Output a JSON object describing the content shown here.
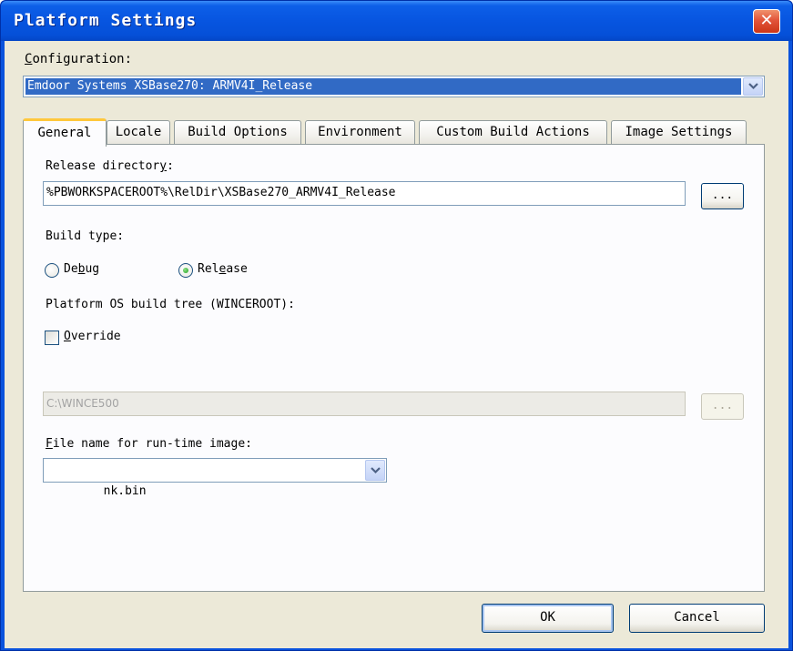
{
  "window": {
    "title": "Platform Settings",
    "close_glyph": "✕"
  },
  "configuration": {
    "label_first": "C",
    "label_rest": "onfiguration:",
    "selected": "Emdoor Systems XSBase270: ARMV4I_Release"
  },
  "tabs": [
    {
      "label": "General",
      "active": true
    },
    {
      "label": "Locale",
      "active": false
    },
    {
      "label": "Build Options",
      "active": false
    },
    {
      "label": "Environment",
      "active": false
    },
    {
      "label": "Custom Build Actions",
      "active": false
    },
    {
      "label": "Image Settings",
      "active": false
    }
  ],
  "general": {
    "release_dir_label_pre": "Release director",
    "release_dir_label_ul": "y",
    "release_dir_label_post": ":",
    "release_dir_value": "%PBWORKSPACEROOT%\\RelDir\\XSBase270_ARMV4I_Release",
    "browse_label": "...",
    "build_type_label": "Build type:",
    "debug_pre": "De",
    "debug_ul": "b",
    "debug_post": "ug",
    "release_pre": "Rel",
    "release_ul": "e",
    "release_post": "ase",
    "build_type_selected": "Release",
    "os_tree_label": "Platform OS build tree (WINCEROOT):",
    "override_ul": "O",
    "override_rest": "verride",
    "override_checked": false,
    "os_tree_value": "C:\\WINCE500",
    "os_browse_label": "...",
    "file_name_label_ul": "F",
    "file_name_label_rest": "ile name for run-time image:",
    "file_name_value": "nk.bin"
  },
  "buttons": {
    "ok": "OK",
    "cancel": "Cancel"
  },
  "colors": {
    "titlebar": "#0755e0",
    "selection": "#316ac5",
    "active_tab_accent": "#ffc83c",
    "close_button": "#e2543a"
  }
}
